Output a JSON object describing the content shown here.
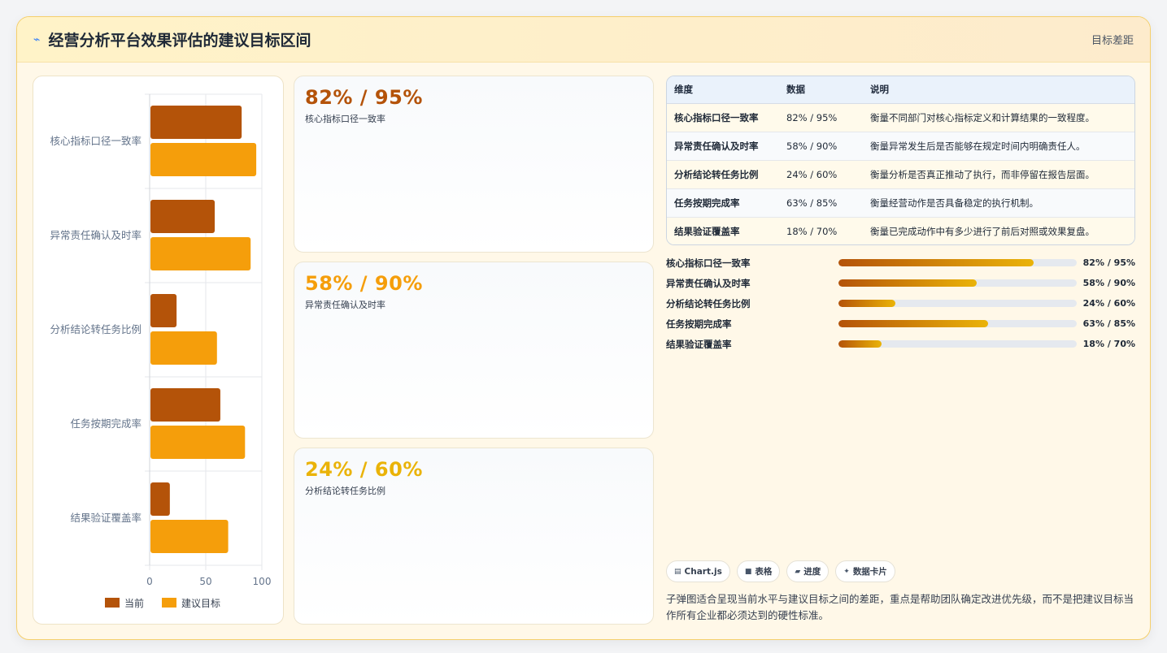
{
  "header": {
    "icon": "chart-spark-icon",
    "title": "经营分析平台效果评估的建议目标区间",
    "tag": "目标差距"
  },
  "chart_data": {
    "type": "bar",
    "orientation": "horizontal",
    "categories": [
      "核心指标口径一致率",
      "异常责任确认及时率",
      "分析结论转任务比例",
      "任务按期完成率",
      "结果验证覆盖率"
    ],
    "series": [
      {
        "name": "当前",
        "values": [
          82,
          58,
          24,
          63,
          18
        ],
        "color": "#b45309"
      },
      {
        "name": "建议目标",
        "values": [
          95,
          90,
          60,
          85,
          70
        ],
        "color": "#f59e0b"
      }
    ],
    "xlim": [
      0,
      100
    ],
    "xticks": [
      "0",
      "50",
      "100"
    ],
    "grid": true,
    "legend": "bottom"
  },
  "kpis": [
    {
      "value": "82% / 95%",
      "label": "核心指标口径一致率",
      "color": "#b45309"
    },
    {
      "value": "58% / 90%",
      "label": "异常责任确认及时率",
      "color": "#f59e0b"
    },
    {
      "value": "24% / 60%",
      "label": "分析结论转任务比例",
      "color": "#eab308"
    }
  ],
  "table": {
    "headers": [
      "维度",
      "数据",
      "说明"
    ],
    "rows": [
      [
        "核心指标口径一致率",
        "82% / 95%",
        "衡量不同部门对核心指标定义和计算结果的一致程度。"
      ],
      [
        "异常责任确认及时率",
        "58% / 90%",
        "衡量异常发生后是否能够在规定时间内明确责任人。"
      ],
      [
        "分析结论转任务比例",
        "24% / 60%",
        "衡量分析是否真正推动了执行，而非停留在报告层面。"
      ],
      [
        "任务按期完成率",
        "63% / 85%",
        "衡量经营动作是否具备稳定的执行机制。"
      ],
      [
        "结果验证覆盖率",
        "18% / 70%",
        "衡量已完成动作中有多少进行了前后对照或效果复盘。"
      ]
    ]
  },
  "progress": [
    {
      "label": "核心指标口径一致率",
      "current": 82,
      "target": 95,
      "text": "82% / 95%"
    },
    {
      "label": "异常责任确认及时率",
      "current": 58,
      "target": 90,
      "text": "58% / 90%"
    },
    {
      "label": "分析结论转任务比例",
      "current": 24,
      "target": 60,
      "text": "24% / 60%"
    },
    {
      "label": "任务按期完成率",
      "current": 63,
      "target": 85,
      "text": "63% / 85%"
    },
    {
      "label": "结果验证覆盖率",
      "current": 18,
      "target": 70,
      "text": "18% / 70%"
    }
  ],
  "chips": [
    {
      "icon": "chart-icon",
      "glyph": "▤",
      "label": "Chart.js"
    },
    {
      "icon": "table-icon",
      "glyph": "■",
      "label": "表格"
    },
    {
      "icon": "progress-icon",
      "glyph": "▰",
      "label": "进度"
    },
    {
      "icon": "card-icon",
      "glyph": "✦",
      "label": "数据卡片"
    }
  ],
  "note": "子弹图适合呈现当前水平与建议目标之间的差距，重点是帮助团队确定改进优先级，而不是把建议目标当作所有企业都必须达到的硬性标准。"
}
